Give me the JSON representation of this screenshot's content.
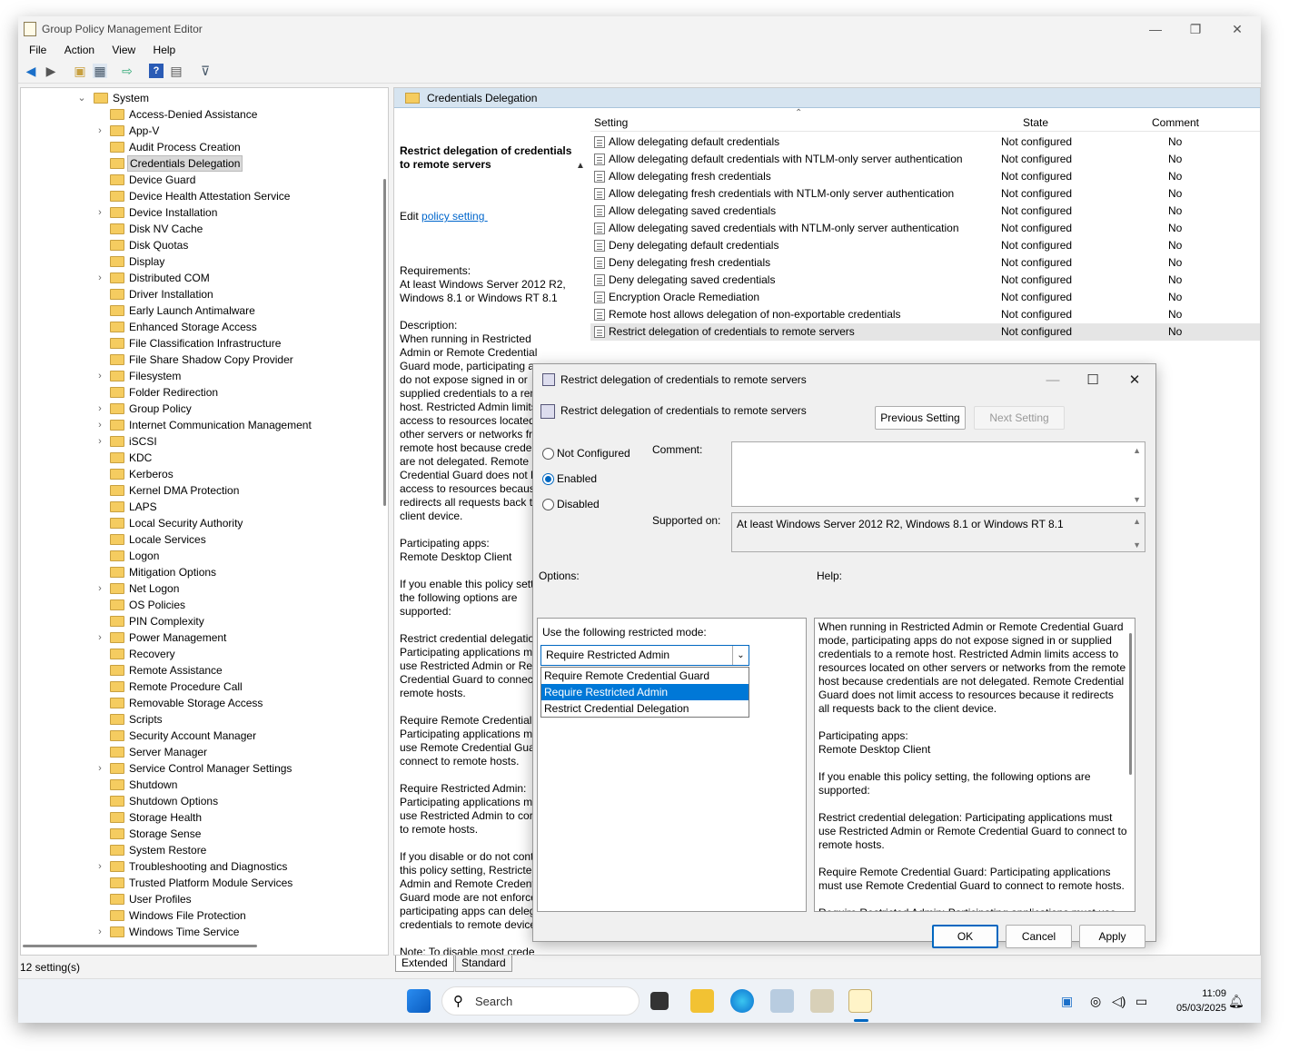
{
  "window": {
    "title": "Group Policy Management Editor",
    "minimize": "—",
    "maximize": "❐",
    "close": "✕"
  },
  "menu": [
    "File",
    "Action",
    "View",
    "Help"
  ],
  "tree": {
    "root": "System",
    "items": [
      {
        "label": "Access-Denied Assistance",
        "exp": false
      },
      {
        "label": "App-V",
        "exp": true
      },
      {
        "label": "Audit Process Creation",
        "exp": false
      },
      {
        "label": "Credentials Delegation",
        "exp": false,
        "selected": true
      },
      {
        "label": "Device Guard",
        "exp": false
      },
      {
        "label": "Device Health Attestation Service",
        "exp": false
      },
      {
        "label": "Device Installation",
        "exp": true
      },
      {
        "label": "Disk NV Cache",
        "exp": false
      },
      {
        "label": "Disk Quotas",
        "exp": false
      },
      {
        "label": "Display",
        "exp": false
      },
      {
        "label": "Distributed COM",
        "exp": true
      },
      {
        "label": "Driver Installation",
        "exp": false
      },
      {
        "label": "Early Launch Antimalware",
        "exp": false
      },
      {
        "label": "Enhanced Storage Access",
        "exp": false
      },
      {
        "label": "File Classification Infrastructure",
        "exp": false
      },
      {
        "label": "File Share Shadow Copy Provider",
        "exp": false
      },
      {
        "label": "Filesystem",
        "exp": true
      },
      {
        "label": "Folder Redirection",
        "exp": false
      },
      {
        "label": "Group Policy",
        "exp": true
      },
      {
        "label": "Internet Communication Management",
        "exp": true
      },
      {
        "label": "iSCSI",
        "exp": true
      },
      {
        "label": "KDC",
        "exp": false
      },
      {
        "label": "Kerberos",
        "exp": false
      },
      {
        "label": "Kernel DMA Protection",
        "exp": false
      },
      {
        "label": "LAPS",
        "exp": false
      },
      {
        "label": "Local Security Authority",
        "exp": false
      },
      {
        "label": "Locale Services",
        "exp": false
      },
      {
        "label": "Logon",
        "exp": false
      },
      {
        "label": "Mitigation Options",
        "exp": false
      },
      {
        "label": "Net Logon",
        "exp": true
      },
      {
        "label": "OS Policies",
        "exp": false
      },
      {
        "label": "PIN Complexity",
        "exp": false
      },
      {
        "label": "Power Management",
        "exp": true
      },
      {
        "label": "Recovery",
        "exp": false
      },
      {
        "label": "Remote Assistance",
        "exp": false
      },
      {
        "label": "Remote Procedure Call",
        "exp": false
      },
      {
        "label": "Removable Storage Access",
        "exp": false
      },
      {
        "label": "Scripts",
        "exp": false
      },
      {
        "label": "Security Account Manager",
        "exp": false
      },
      {
        "label": "Server Manager",
        "exp": false
      },
      {
        "label": "Service Control Manager Settings",
        "exp": true
      },
      {
        "label": "Shutdown",
        "exp": false
      },
      {
        "label": "Shutdown Options",
        "exp": false
      },
      {
        "label": "Storage Health",
        "exp": false
      },
      {
        "label": "Storage Sense",
        "exp": false
      },
      {
        "label": "System Restore",
        "exp": false
      },
      {
        "label": "Troubleshooting and Diagnostics",
        "exp": true
      },
      {
        "label": "Trusted Platform Module Services",
        "exp": false
      },
      {
        "label": "User Profiles",
        "exp": false
      },
      {
        "label": "Windows File Protection",
        "exp": false
      },
      {
        "label": "Windows Time Service",
        "exp": true
      }
    ]
  },
  "right": {
    "header": "Credentials Delegation",
    "desc_title": "Restrict delegation of credentials to remote servers",
    "desc_edit": "Edit ",
    "desc_link": "policy setting ",
    "desc_body": "Requirements:\nAt least Windows Server 2012 R2,\nWindows 8.1 or Windows RT 8.1\n\nDescription:\nWhen running in Restricted\nAdmin or Remote Credential\nGuard mode, participating apps\ndo not expose signed in or\nsupplied credentials to a remote\nhost. Restricted Admin limits\naccess to resources located on\nother servers or networks from the\nremote host because creder\nare not delegated. Remote\nCredential Guard does not li\naccess to resources because\nredirects all requests back to\nclient device.\n\nParticipating apps:\nRemote Desktop Client\n\nIf you enable this policy sett\nthe following options are\nsupported:\n\nRestrict credential delegatio\nParticipating applications m\nuse Restricted Admin or Rer\nCredential Guard to connect\nremote hosts.\n\nRequire Remote Credential (\nParticipating applications m\nuse Remote Credential Guar\nconnect to remote hosts.\n\nRequire Restricted Admin:\nParticipating applications m\nuse Restricted Admin to cor\nto remote hosts.\n\nIf you disable or do not cont\nthis policy setting, Restricte\nAdmin and Remote Credent\nGuard mode are not enforce\nparticipating apps can deleg\ncredentials to remote device\n\nNote: To disable most crede\ndelegation, it may be suffici\ndeny delegation in Credenti\nSecurity Support Provider\n(CredSSP) by modifying",
    "columns": {
      "setting": "Setting",
      "state": "State",
      "comment": "Comment"
    },
    "rows": [
      {
        "name": "Allow delegating default credentials",
        "state": "Not configured",
        "comment": "No"
      },
      {
        "name": "Allow delegating default credentials with NTLM-only server authentication",
        "state": "Not configured",
        "comment": "No"
      },
      {
        "name": "Allow delegating fresh credentials",
        "state": "Not configured",
        "comment": "No"
      },
      {
        "name": "Allow delegating fresh credentials with NTLM-only server authentication",
        "state": "Not configured",
        "comment": "No"
      },
      {
        "name": "Allow delegating saved credentials",
        "state": "Not configured",
        "comment": "No"
      },
      {
        "name": "Allow delegating saved credentials with NTLM-only server authentication",
        "state": "Not configured",
        "comment": "No"
      },
      {
        "name": "Deny delegating default credentials",
        "state": "Not configured",
        "comment": "No"
      },
      {
        "name": "Deny delegating fresh credentials",
        "state": "Not configured",
        "comment": "No"
      },
      {
        "name": "Deny delegating saved credentials",
        "state": "Not configured",
        "comment": "No"
      },
      {
        "name": "Encryption Oracle Remediation",
        "state": "Not configured",
        "comment": "No"
      },
      {
        "name": "Remote host allows delegation of non-exportable credentials",
        "state": "Not configured",
        "comment": "No"
      },
      {
        "name": "Restrict delegation of credentials to remote servers",
        "state": "Not configured",
        "comment": "No",
        "selected": true
      }
    ],
    "tabs": [
      "Extended",
      "Standard"
    ]
  },
  "status": "12 setting(s)",
  "dialog": {
    "title": "Restrict delegation of credentials to remote servers",
    "heading": "Restrict delegation of credentials to remote servers",
    "prev": "Previous Setting",
    "next": "Next Setting",
    "radios": {
      "not_configured": "Not Configured",
      "enabled": "Enabled",
      "disabled": "Disabled",
      "selected": "Enabled"
    },
    "comment_label": "Comment:",
    "supported_label": "Supported on:",
    "supported_value": "At least Windows Server 2012 R2, Windows 8.1 or Windows RT 8.1",
    "options_label": "Options:",
    "help_label": "Help:",
    "mode_label": "Use the following restricted mode:",
    "mode_selected": "Require Restricted Admin",
    "mode_options": [
      "Require Remote Credential Guard",
      "Require Restricted Admin",
      "Restrict Credential Delegation"
    ],
    "help_text": "When running in Restricted Admin or Remote Credential Guard mode, participating apps do not expose signed in or supplied credentials to a remote host. Restricted Admin limits access to resources located on other servers or networks from the remote host because credentials are not delegated. Remote Credential Guard does not limit access to resources because it redirects all requests back to the client device.\n\nParticipating apps:\nRemote Desktop Client\n\nIf you enable this policy setting, the following options are supported:\n\nRestrict credential delegation: Participating applications must use Restricted Admin or Remote Credential Guard to connect to remote hosts.\n\nRequire Remote Credential Guard: Participating applications must use Remote Credential Guard to connect to remote hosts.\n\nRequire Restricted Admin: Participating applications must use Restricted Admin to connect to remote hosts.",
    "ok": "OK",
    "cancel": "Cancel",
    "apply": "Apply"
  },
  "taskbar": {
    "search": "Search",
    "time": "11:09",
    "date": "05/03/2025"
  }
}
